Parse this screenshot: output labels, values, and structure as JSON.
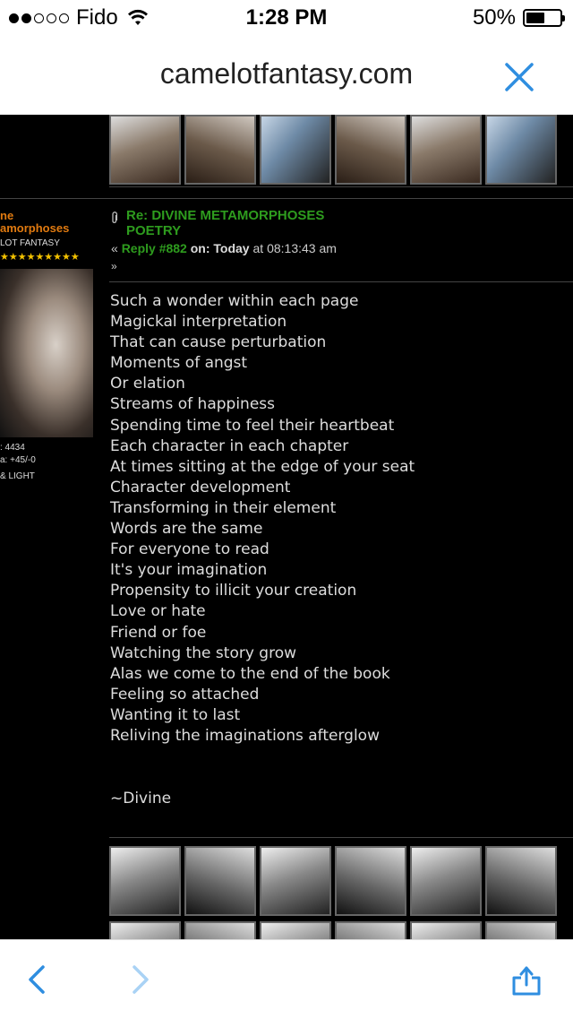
{
  "status_bar": {
    "carrier": "Fido",
    "time": "1:28 PM",
    "battery": "50%"
  },
  "address_bar": {
    "url": "camelotfantasy.com"
  },
  "author": {
    "name_line1": "ne",
    "name_line2": "amorphoses",
    "group": "LOT FANTASY",
    "stars": "★★★★★★★★★",
    "posts": ": 4434",
    "karma": "a: +45/-0",
    "personal_text": "& LIGHT"
  },
  "post": {
    "title": "Re: DIVINE METAMORPHOSES POETRY",
    "laquo": "«",
    "reply_label": "Reply #882",
    "on_label": "on:",
    "date": "Today",
    "time_suffix": "at 08:13:43 am",
    "raquo": "»",
    "poem_lines": [
      "Such a wonder within each page",
      "Magickal interpretation",
      "That can cause perturbation",
      "Moments of angst",
      "Or elation",
      "Streams of happiness",
      "Spending time to feel their heartbeat",
      "Each character in each chapter",
      "At times sitting at the edge of your seat",
      "Character development",
      "Transforming in their element",
      "Words are the same",
      "For everyone to read",
      "It's your imagination",
      "Propensity to illicit your creation",
      "Love or hate",
      "Friend or foe",
      "Watching the story grow",
      "Alas we come to the end of the book",
      "Feeling so attached",
      "Wanting it to last",
      "Reliving the imaginations afterglow"
    ],
    "signature": "~Divine"
  },
  "colors": {
    "accent": "#2e9c1e",
    "username": "#e07a10",
    "ios_blue": "#2f8ee0"
  },
  "icons": {
    "close": "close-icon",
    "back": "chevron-left-icon",
    "forward": "chevron-right-icon",
    "share": "share-icon"
  }
}
